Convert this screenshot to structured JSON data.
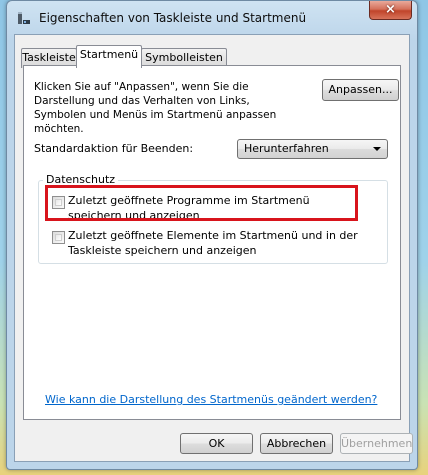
{
  "window": {
    "title": "Eigenschaften von Taskleiste und Startmenü",
    "close_glyph": "×"
  },
  "tabs": [
    {
      "label": "Taskleiste",
      "active": false
    },
    {
      "label": "Startmenü",
      "active": true
    },
    {
      "label": "Symbolleisten",
      "active": false
    }
  ],
  "start_tab": {
    "description": "Klicken Sie auf \"Anpassen\", wenn Sie die Darstellung und das Verhalten von Links, Symbolen und Menüs im Startmenü anpassen möchten.",
    "customize_button": "Anpassen...",
    "power_label": "Standardaktion für Beenden:",
    "power_select_value": "Herunterfahren",
    "privacy": {
      "group_title": "Datenschutz",
      "options": [
        {
          "label": "Zuletzt geöffnete Programme im Startmenü speichern und anzeigen",
          "checked": false
        },
        {
          "label": "Zuletzt geöffnete Elemente im Startmenü und in der Taskleiste speichern und anzeigen",
          "checked": false
        }
      ]
    },
    "help_link": "Wie kann die Darstellung des Startmenüs geändert werden?"
  },
  "footer": {
    "ok": "OK",
    "cancel": "Abbrechen",
    "apply": "Übernehmen"
  },
  "colors": {
    "highlight_border": "#d8141c",
    "link": "#0066cc",
    "close_button": "#c0442a"
  },
  "icons": {
    "app": "taskbar-properties-icon",
    "close": "close-icon",
    "dropdown": "chevron-down-icon"
  }
}
